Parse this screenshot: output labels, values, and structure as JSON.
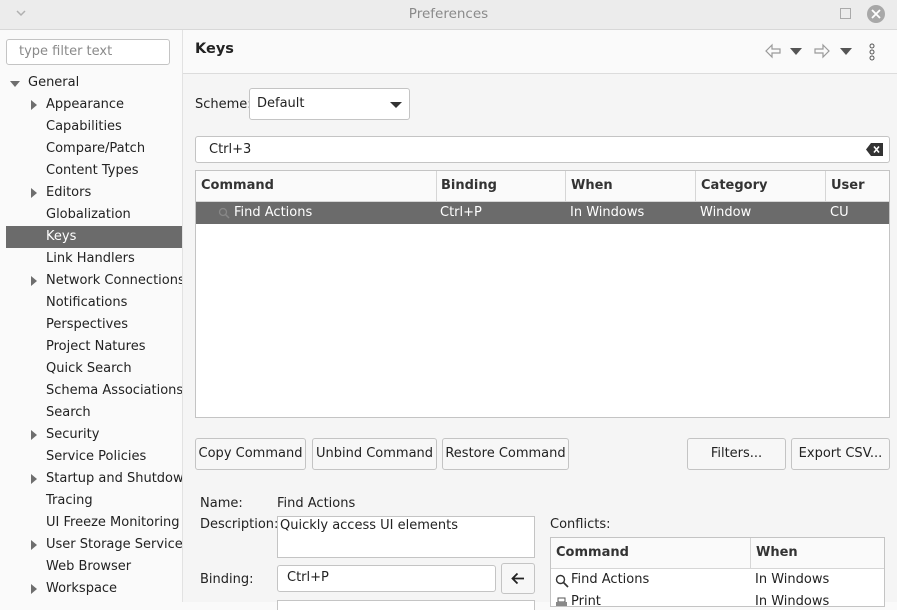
{
  "window": {
    "title": "Preferences"
  },
  "sidebar": {
    "filter_placeholder": "type filter text",
    "root_label": "General",
    "items": [
      {
        "label": "Appearance",
        "expandable": true
      },
      {
        "label": "Capabilities",
        "expandable": false
      },
      {
        "label": "Compare/Patch",
        "expandable": false
      },
      {
        "label": "Content Types",
        "expandable": false
      },
      {
        "label": "Editors",
        "expandable": true
      },
      {
        "label": "Globalization",
        "expandable": false
      },
      {
        "label": "Keys",
        "expandable": false,
        "selected": true
      },
      {
        "label": "Link Handlers",
        "expandable": false
      },
      {
        "label": "Network Connections",
        "expandable": true
      },
      {
        "label": "Notifications",
        "expandable": false
      },
      {
        "label": "Perspectives",
        "expandable": false
      },
      {
        "label": "Project Natures",
        "expandable": false
      },
      {
        "label": "Quick Search",
        "expandable": false
      },
      {
        "label": "Schema Associations",
        "expandable": false
      },
      {
        "label": "Search",
        "expandable": false
      },
      {
        "label": "Security",
        "expandable": true
      },
      {
        "label": "Service Policies",
        "expandable": false
      },
      {
        "label": "Startup and Shutdown",
        "expandable": true
      },
      {
        "label": "Tracing",
        "expandable": false
      },
      {
        "label": "UI Freeze Monitoring",
        "expandable": false
      },
      {
        "label": "User Storage Service",
        "expandable": true
      },
      {
        "label": "Web Browser",
        "expandable": false
      },
      {
        "label": "Workspace",
        "expandable": true
      }
    ]
  },
  "main": {
    "title": "Keys",
    "scheme_label": "Scheme:",
    "scheme_value": "Default",
    "search_value": "Ctrl+3",
    "table": {
      "columns": [
        "Command",
        "Binding",
        "When",
        "Category",
        "User"
      ],
      "rows": [
        {
          "command": "Find Actions",
          "binding": "Ctrl+P",
          "when": "In Windows",
          "category": "Window",
          "user": "CU",
          "selected": true
        }
      ]
    },
    "buttons": {
      "copy": "Copy Command",
      "unbind": "Unbind Command",
      "restore": "Restore Command",
      "filters": "Filters...",
      "export": "Export CSV..."
    },
    "details": {
      "name_label": "Name:",
      "name_value": "Find Actions",
      "description_label": "Description:",
      "description_value": "Quickly access UI elements",
      "binding_label": "Binding:",
      "binding_value": "Ctrl+P"
    },
    "conflicts": {
      "label": "Conflicts:",
      "columns": [
        "Command",
        "When"
      ],
      "rows": [
        {
          "command": "Find Actions",
          "when": "In Windows"
        },
        {
          "command": "Print",
          "when": "In Windows"
        }
      ]
    }
  },
  "colors": {
    "selection": "#6b6b6b",
    "background": "#f5f5f5"
  }
}
